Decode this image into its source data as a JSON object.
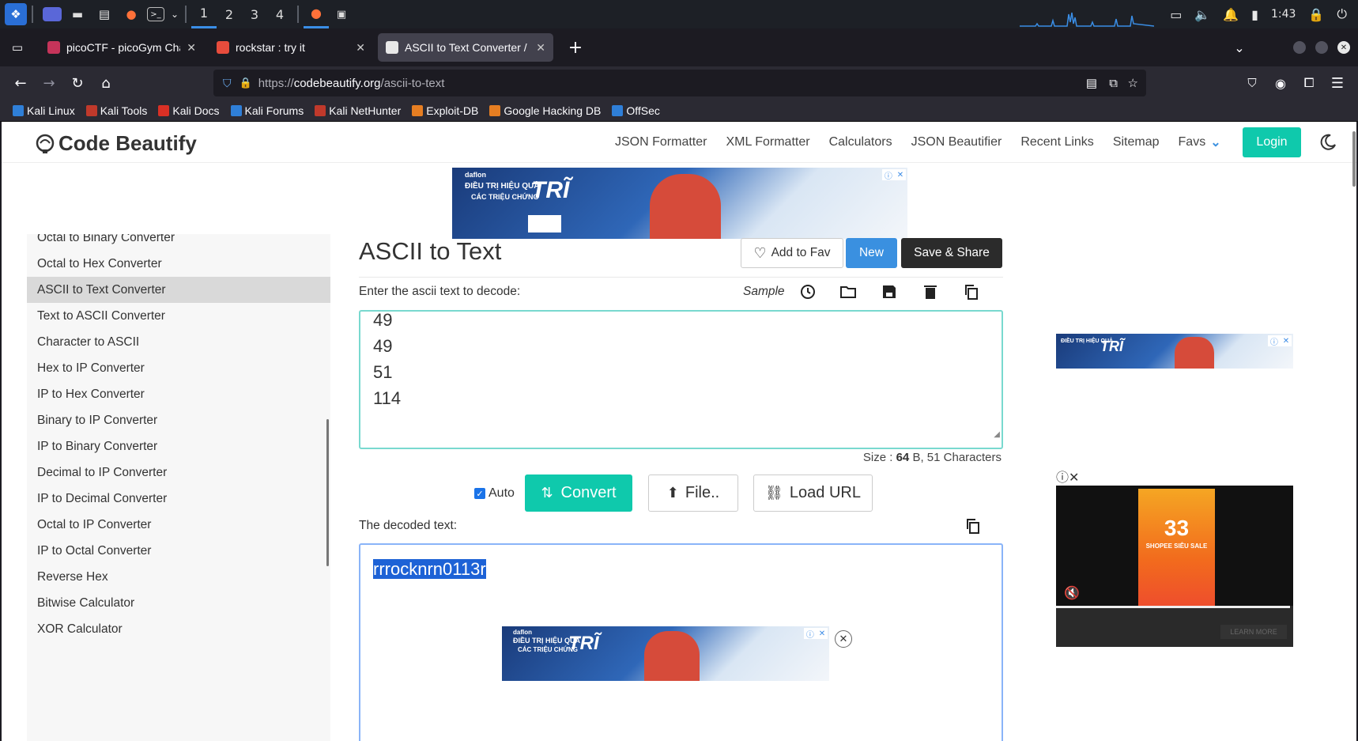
{
  "taskbar": {
    "workspaces": [
      "1",
      "2",
      "3",
      "4"
    ],
    "clock": "1:43"
  },
  "tabs": [
    {
      "title": "picoCTF - picoGym Challe",
      "color": "#c5345a"
    },
    {
      "title": "rockstar : try it",
      "color": "#e74c3c"
    },
    {
      "title": "ASCII to Text Converter / ",
      "color": "#e8e8e8"
    }
  ],
  "urlbar": {
    "scheme": "https://",
    "host": "codebeautify.org",
    "path": "/ascii-to-text"
  },
  "bookmarks": [
    {
      "label": "Kali Linux",
      "color": "#2f7fd8"
    },
    {
      "label": "Kali Tools",
      "color": "#c0392b"
    },
    {
      "label": "Kali Docs",
      "color": "#d93025"
    },
    {
      "label": "Kali Forums",
      "color": "#2f7fd8"
    },
    {
      "label": "Kali NetHunter",
      "color": "#c0392b"
    },
    {
      "label": "Exploit-DB",
      "color": "#e67e22"
    },
    {
      "label": "Google Hacking DB",
      "color": "#e67e22"
    },
    {
      "label": "OffSec",
      "color": "#2f7fd8"
    }
  ],
  "site": {
    "logo": "Code Beautify",
    "menu": [
      "JSON Formatter",
      "XML Formatter",
      "Calculators",
      "JSON Beautifier",
      "Recent Links",
      "Sitemap",
      "Favs"
    ],
    "login": "Login"
  },
  "ads": {
    "top_brand": "daflon",
    "top_headline": "ĐIỀU TRỊ HIỆU QUẢ",
    "top_sub": "CÁC TRIỆU CHỨNG",
    "top_big": "TRĨ",
    "shopee_big": "33",
    "shopee_sub": "SHOPEE SIÊU SALE",
    "shopee_cta": "LEARN MORE"
  },
  "sidebar": {
    "items": [
      "Octal to Binary Converter",
      "Octal to Hex Converter",
      "ASCII to Text Converter",
      "Text to ASCII Converter",
      "Character to ASCII",
      "Hex to IP Converter",
      "IP to Hex Converter",
      "Binary to IP Converter",
      "IP to Binary Converter",
      "Decimal to IP Converter",
      "IP to Decimal Converter",
      "Octal to IP Converter",
      "IP to Octal Converter",
      "Reverse Hex",
      "Bitwise Calculator",
      "XOR Calculator"
    ],
    "active_index": 2
  },
  "main": {
    "title": "ASCII to Text",
    "add_fav": "Add to Fav",
    "new": "New",
    "save_share": "Save & Share",
    "input_label": "Enter the ascii text to decode:",
    "sample": "Sample",
    "input_lines": [
      "49",
      "49",
      "51",
      "114"
    ],
    "size_prefix": "Size : ",
    "size_bytes": "64",
    "size_suffix": " B, 51 Characters",
    "auto_label": "Auto",
    "convert": "Convert",
    "file": "File..",
    "load_url": "Load URL",
    "output_label": "The decoded text:",
    "output_value": "rrrocknrn0113r"
  }
}
